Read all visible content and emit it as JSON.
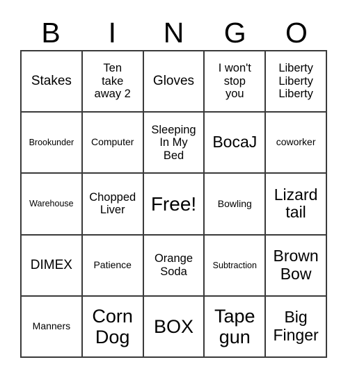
{
  "card": {
    "header_letters": [
      "B",
      "I",
      "N",
      "G",
      "O"
    ],
    "columns": 5,
    "rows": 5,
    "border_color": "#3a3a3a",
    "background_color": "#ffffff",
    "text_color": "#000000",
    "cells": [
      {
        "text": "Stakes",
        "size": "lg",
        "row": 1,
        "col": 1
      },
      {
        "text": "Ten\ntake\naway 2",
        "size": "md",
        "row": 1,
        "col": 2
      },
      {
        "text": "Gloves",
        "size": "lg",
        "row": 1,
        "col": 3
      },
      {
        "text": "I won't\nstop\nyou",
        "size": "md",
        "row": 1,
        "col": 4
      },
      {
        "text": "Liberty\nLiberty\nLiberty",
        "size": "md",
        "row": 1,
        "col": 5
      },
      {
        "text": "Brookunder",
        "size": "xs",
        "row": 2,
        "col": 1
      },
      {
        "text": "Computer",
        "size": "sm",
        "row": 2,
        "col": 2
      },
      {
        "text": "Sleeping\nIn My\nBed",
        "size": "md",
        "row": 2,
        "col": 3
      },
      {
        "text": "BocaJ",
        "size": "xl",
        "row": 2,
        "col": 4
      },
      {
        "text": "coworker",
        "size": "sm",
        "row": 2,
        "col": 5
      },
      {
        "text": "Warehouse",
        "size": "xs",
        "row": 3,
        "col": 1
      },
      {
        "text": "Chopped\nLiver",
        "size": "md",
        "row": 3,
        "col": 2
      },
      {
        "text": "Free!",
        "size": "free",
        "row": 3,
        "col": 3
      },
      {
        "text": "Bowling",
        "size": "sm",
        "row": 3,
        "col": 4
      },
      {
        "text": "Lizard\ntail",
        "size": "xl",
        "row": 3,
        "col": 5
      },
      {
        "text": "DIMEX",
        "size": "lg",
        "row": 4,
        "col": 1
      },
      {
        "text": "Patience",
        "size": "sm",
        "row": 4,
        "col": 2
      },
      {
        "text": "Orange\nSoda",
        "size": "md",
        "row": 4,
        "col": 3
      },
      {
        "text": "Subtraction",
        "size": "xs",
        "row": 4,
        "col": 4
      },
      {
        "text": "Brown\nBow",
        "size": "xl",
        "row": 4,
        "col": 5
      },
      {
        "text": "Manners",
        "size": "sm",
        "row": 5,
        "col": 1
      },
      {
        "text": "Corn\nDog",
        "size": "xxl",
        "row": 5,
        "col": 2
      },
      {
        "text": "BOX",
        "size": "xxl",
        "row": 5,
        "col": 3
      },
      {
        "text": "Tape\ngun",
        "size": "xxl",
        "row": 5,
        "col": 4
      },
      {
        "text": "Big\nFinger",
        "size": "xl",
        "row": 5,
        "col": 5
      }
    ]
  }
}
